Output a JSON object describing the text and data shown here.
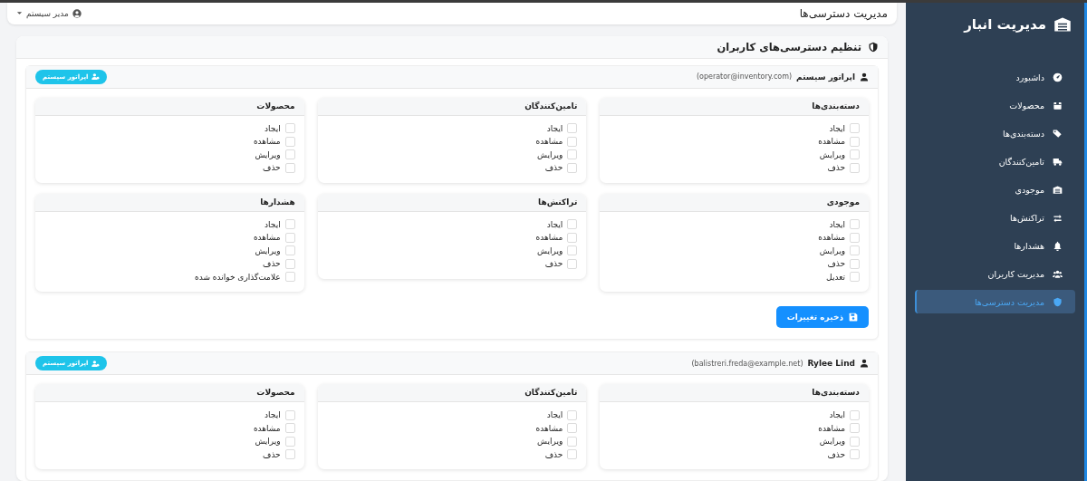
{
  "sidebar": {
    "brand": "مدیریت انبار",
    "items": [
      {
        "label": "داشبورد",
        "selected": false
      },
      {
        "label": "محصولات",
        "selected": false
      },
      {
        "label": "دسته‌بندی‌ها",
        "selected": false
      },
      {
        "label": "تامین‌کنندگان",
        "selected": false
      },
      {
        "label": "موجودی",
        "selected": false
      },
      {
        "label": "تراکنش‌ها",
        "selected": false
      },
      {
        "label": "هشدارها",
        "selected": false
      },
      {
        "label": "مدیریت کاربران",
        "selected": false
      },
      {
        "label": "مدیریت دسترسی‌ها",
        "selected": true
      }
    ]
  },
  "topbar": {
    "title": "مدیریت دسترسی‌ها",
    "user_menu": "مدیر سیستم"
  },
  "panel": {
    "title": "تنظیم دسترسی‌های کاربران",
    "users": [
      {
        "name": "اپراتور سیستم",
        "email": "(operator@inventory.com)",
        "badge": "اپراتور سیستم",
        "modules": [
          {
            "title": "دسته‌بندی‌ها",
            "permissions": [
              {
                "label": "ایجاد",
                "checked": false
              },
              {
                "label": "مشاهده",
                "checked": false
              },
              {
                "label": "ویرایش",
                "checked": false
              },
              {
                "label": "حذف",
                "checked": false
              }
            ]
          },
          {
            "title": "تامین‌کنندگان",
            "permissions": [
              {
                "label": "ایجاد",
                "checked": false
              },
              {
                "label": "مشاهده",
                "checked": false
              },
              {
                "label": "ویرایش",
                "checked": false
              },
              {
                "label": "حذف",
                "checked": false
              }
            ]
          },
          {
            "title": "محصولات",
            "permissions": [
              {
                "label": "ایجاد",
                "checked": false
              },
              {
                "label": "مشاهده",
                "checked": false
              },
              {
                "label": "ویرایش",
                "checked": false
              },
              {
                "label": "حذف",
                "checked": false
              }
            ]
          },
          {
            "title": "موجودی",
            "permissions": [
              {
                "label": "ایجاد",
                "checked": false
              },
              {
                "label": "مشاهده",
                "checked": false
              },
              {
                "label": "ویرایش",
                "checked": false
              },
              {
                "label": "حذف",
                "checked": false
              },
              {
                "label": "تعدیل",
                "checked": false
              }
            ]
          },
          {
            "title": "تراکنش‌ها",
            "permissions": [
              {
                "label": "ایجاد",
                "checked": false
              },
              {
                "label": "مشاهده",
                "checked": false
              },
              {
                "label": "ویرایش",
                "checked": false
              },
              {
                "label": "حذف",
                "checked": false
              }
            ]
          },
          {
            "title": "هشدارها",
            "permissions": [
              {
                "label": "ایجاد",
                "checked": false
              },
              {
                "label": "مشاهده",
                "checked": false
              },
              {
                "label": "ویرایش",
                "checked": false
              },
              {
                "label": "حذف",
                "checked": false
              },
              {
                "label": "علامت‌گذاری خوانده شده",
                "checked": false
              }
            ]
          }
        ],
        "save_button": "ذخیره تغییرات"
      },
      {
        "name": "Rylee Lind",
        "email": "(balistreri.freda@example.net)",
        "badge": "اپراتور سیستم",
        "modules": [
          {
            "title": "دسته‌بندی‌ها",
            "permissions": [
              {
                "label": "ایجاد",
                "checked": false
              },
              {
                "label": "مشاهده",
                "checked": false
              },
              {
                "label": "ویرایش",
                "checked": false
              },
              {
                "label": "حذف",
                "checked": false
              }
            ]
          },
          {
            "title": "تامین‌کنندگان",
            "permissions": [
              {
                "label": "ایجاد",
                "checked": false
              },
              {
                "label": "مشاهده",
                "checked": false
              },
              {
                "label": "ویرایش",
                "checked": false
              },
              {
                "label": "حذف",
                "checked": false
              }
            ]
          },
          {
            "title": "محصولات",
            "permissions": [
              {
                "label": "ایجاد",
                "checked": false
              },
              {
                "label": "مشاهده",
                "checked": false
              },
              {
                "label": "ویرایش",
                "checked": false
              },
              {
                "label": "حذف",
                "checked": false
              }
            ]
          }
        ]
      }
    ]
  }
}
